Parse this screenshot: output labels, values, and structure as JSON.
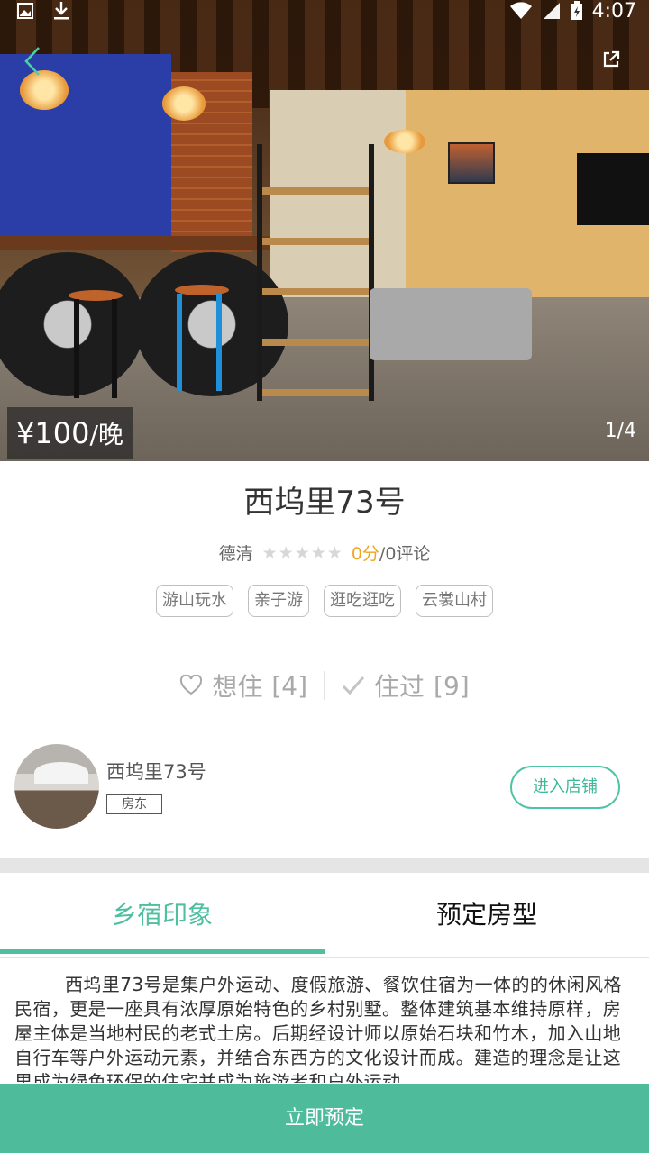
{
  "status_bar": {
    "time": "4:07",
    "icons": [
      "image-icon",
      "download-icon",
      "wifi-icon",
      "signal-icon",
      "battery-charging-icon"
    ]
  },
  "gallery": {
    "price_amount": "¥100",
    "price_unit": "/晚",
    "counter": "1/4"
  },
  "listing": {
    "title": "西坞里73号",
    "location": "德清",
    "rating_stars": 0,
    "score": "0分",
    "reviews": "/0评论",
    "tags": [
      "游山玩水",
      "亲子游",
      "逛吃逛吃",
      "云裳山村"
    ]
  },
  "actions": {
    "want_label": "想住",
    "want_count": "[4]",
    "stayed_label": "住过",
    "stayed_count": "[9]"
  },
  "host": {
    "name": "西坞里73号",
    "role": "房东",
    "shop_button": "进入店铺"
  },
  "tabs": {
    "impression": "乡宿印象",
    "room_types": "预定房型",
    "active": "impression"
  },
  "description": "西坞里73号是集户外运动、度假旅游、餐饮住宿为一体的的休闲风格民宿，更是一座具有浓厚原始特色的乡村别墅。整体建筑基本维持原样，房屋主体是当地村民的老式土房。后期经设计师以原始石块和竹木，加入山地自行车等户外运动元素，并结合东西方的文化设计而成。建造的理念是让这里成为绿色环保的住宅并成为旅游者和户外运动",
  "book_button": "立即预定",
  "colors": {
    "accent": "#4fbf9f",
    "score": "#f0a520"
  }
}
